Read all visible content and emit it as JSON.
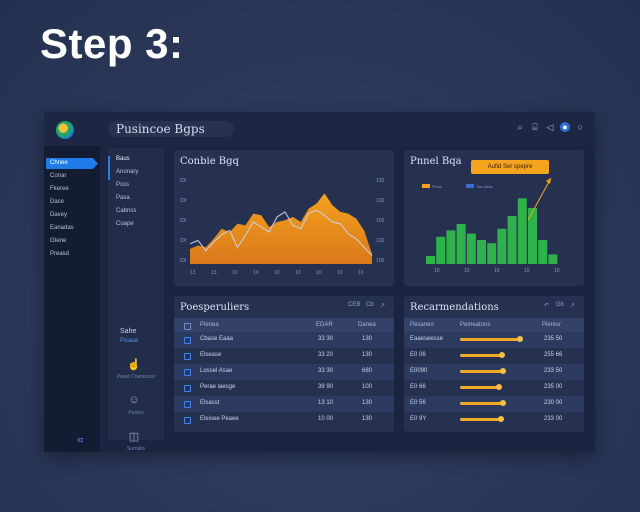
{
  "heading": "Step 3:",
  "app": {
    "name": "Pusincoe Bgps",
    "toolbar_icons": [
      "zoom-icon",
      "expand-icon",
      "send-icon",
      "user-icon",
      "help-icon"
    ],
    "toolbar_glyphs": [
      "⌕",
      "⌸",
      "◁",
      "●",
      "○"
    ]
  },
  "sidebar": {
    "items": [
      "Chnee",
      "Conar",
      "Fkeree",
      "Dace",
      "Davey",
      "Eanadas",
      "Gtene",
      "Preasd"
    ],
    "active_index": 0,
    "footer": "◦◘"
  },
  "subnav": {
    "items": [
      "Baus",
      "Anonary",
      "Psss",
      "Pasa",
      "Cabnss",
      "Coape"
    ],
    "section_title": "Sahe",
    "section_sub": "Poiase",
    "cards": [
      {
        "glyph": "☝",
        "caption": "Paset Coanecast"
      },
      {
        "glyph": "☺",
        "caption": "Pastes"
      },
      {
        "glyph": "◫",
        "caption": "Surnalis"
      }
    ]
  },
  "chart1": {
    "title": "Conbie Bgq",
    "yticks_left": [
      "IDI",
      "IDI",
      "IDI",
      "IDI",
      "IDI"
    ],
    "yticks_right": [
      "120",
      "130",
      "150",
      "120",
      "100"
    ],
    "xticks": [
      "13",
      "13",
      "10",
      "10",
      "10",
      "10",
      "10",
      "10",
      "10"
    ]
  },
  "chart_data": {
    "type": "area",
    "title": "Conbie Bgq",
    "series": [
      {
        "values": [
          18,
          22,
          20,
          30,
          42,
          38,
          48,
          46,
          60,
          58,
          44,
          50,
          52,
          56,
          50,
          66,
          72,
          84,
          70,
          62,
          60,
          54,
          40,
          12
        ]
      },
      {
        "values": [
          24,
          28,
          16,
          26,
          35,
          40,
          20,
          34,
          50,
          44,
          38,
          56,
          62,
          46,
          42,
          60,
          64,
          58,
          50,
          48,
          36,
          30,
          20,
          10
        ]
      }
    ],
    "colors": {
      "area": "#f5a11e",
      "area_dark": "#d9791a",
      "line": "#c8d4ee"
    }
  },
  "chart2": {
    "title": "Pnnel Bqa",
    "callout": "Aufid Ser spepre",
    "legend": [
      "Pccar",
      "Yas ertas"
    ],
    "xticks": [
      "10",
      "10",
      "10",
      "10",
      "10"
    ],
    "bars": [
      10,
      34,
      42,
      50,
      38,
      30,
      26,
      44,
      60,
      82,
      70,
      30,
      12
    ],
    "color": "#2fb14c"
  },
  "table1": {
    "title": "Poesperuliers",
    "actions": [
      "CEB",
      "Cb",
      "↗"
    ],
    "headers": [
      "Pienea",
      "EDAR",
      "Danea"
    ],
    "rows": [
      [
        "Cbase Eaaa",
        "33 30",
        "130"
      ],
      [
        "Elsease",
        "33 20",
        "130"
      ],
      [
        "Lossel Asae",
        "33 30",
        "680"
      ],
      [
        "Perae laesge",
        "39 90",
        "100"
      ],
      [
        "Elsasst",
        "13 10",
        "130"
      ],
      [
        "Eleisee Peaee",
        "10 00",
        "130"
      ]
    ]
  },
  "table2": {
    "title": "Recarmendations",
    "actions": [
      "↶",
      "Gb",
      "↗"
    ],
    "headers": [
      "Pesaneo",
      "Pemeatons",
      "Pieresr"
    ],
    "rows": [
      [
        "Eaaeseesse",
        0.85,
        "235 50"
      ],
      [
        "E0 06",
        0.6,
        "255 66"
      ],
      [
        "E0090",
        0.62,
        "233 50"
      ],
      [
        "E0 66",
        0.55,
        "235 00"
      ],
      [
        "E0 56",
        0.62,
        "230 00"
      ],
      [
        "E0 9Y",
        0.58,
        "233 00"
      ]
    ]
  }
}
